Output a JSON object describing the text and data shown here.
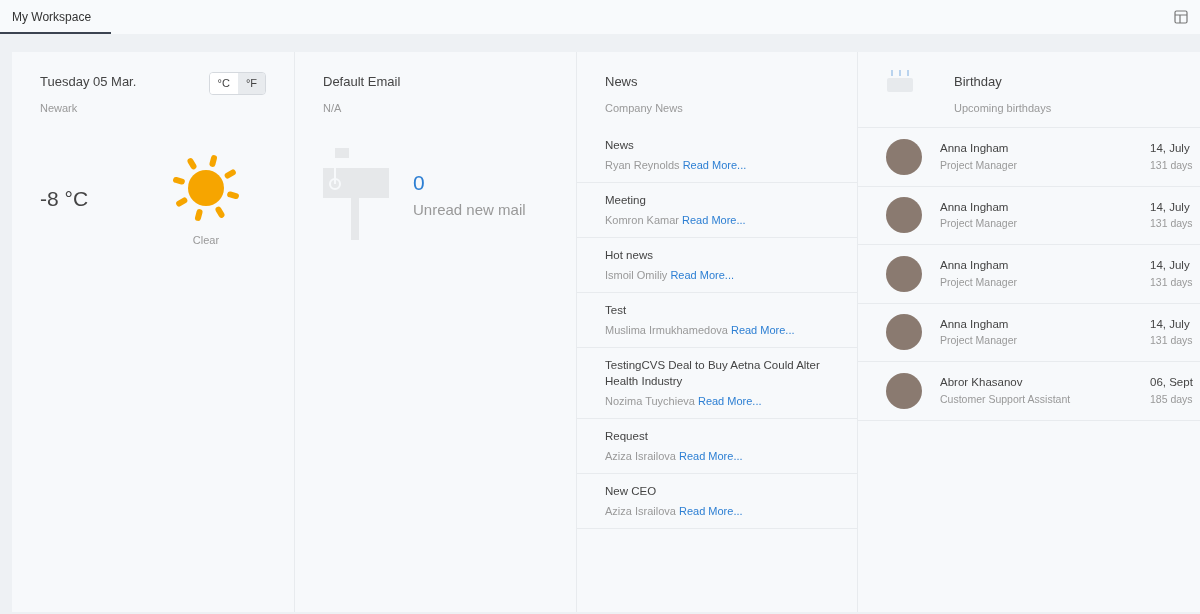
{
  "tabs": [
    {
      "label": "My Workspace",
      "selected": true
    }
  ],
  "weather": {
    "date": "Tuesday 05 Mar.",
    "location": "Newark",
    "units": [
      {
        "label": "°C",
        "selected": false
      },
      {
        "label": "°F",
        "selected": true
      }
    ],
    "temperature": "-8 °C",
    "condition": "Clear"
  },
  "email": {
    "title": "Default Email",
    "account": "N/A",
    "count": "0",
    "caption": "Unread new mail"
  },
  "news": {
    "title": "News",
    "subtitle": "Company News",
    "items": [
      {
        "title": "News",
        "author": "Ryan Reynolds",
        "link": "Read More..."
      },
      {
        "title": "Meeting",
        "author": "Komron Kamar",
        "link": "Read More..."
      },
      {
        "title": "Hot news",
        "author": "Ismoil Omiliy",
        "link": "Read More..."
      },
      {
        "title": "Test",
        "author": "Muslima Irmukhamedova",
        "link": "Read More..."
      },
      {
        "title": "TestingCVS Deal to Buy Aetna Could Alter Health Industry",
        "author": "Nozima Tuychieva",
        "link": "Read More..."
      },
      {
        "title": "Request",
        "author": "Aziza Israilova",
        "link": "Read More..."
      },
      {
        "title": "New CEO",
        "author": "Aziza Israilova",
        "link": "Read More..."
      }
    ]
  },
  "birthday": {
    "title": "Birthday",
    "subtitle": "Upcoming birthdays",
    "people": [
      {
        "name": "Anna Ingham",
        "role": "Project Manager",
        "date": "14, July",
        "days": "131 days"
      },
      {
        "name": "Anna Ingham",
        "role": "Project Manager",
        "date": "14, July",
        "days": "131 days"
      },
      {
        "name": "Anna Ingham",
        "role": "Project Manager",
        "date": "14, July",
        "days": "131 days"
      },
      {
        "name": "Anna Ingham",
        "role": "Project Manager",
        "date": "14, July",
        "days": "131 days"
      },
      {
        "name": "Abror Khasanov",
        "role": "Customer Support Assistant",
        "date": "06, Sept",
        "days": "185 days"
      }
    ]
  }
}
